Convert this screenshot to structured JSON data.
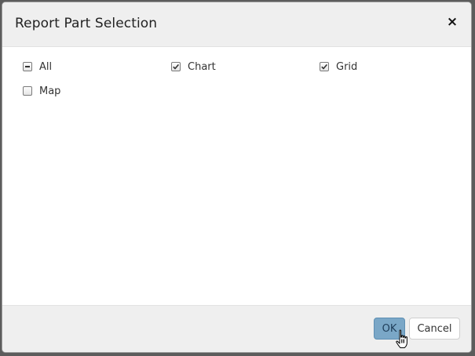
{
  "dialog": {
    "title": "Report Part Selection",
    "close_glyph": "×",
    "options": [
      {
        "label": "All",
        "state": "indeterminate"
      },
      {
        "label": "Chart",
        "state": "checked"
      },
      {
        "label": "Grid",
        "state": "checked"
      },
      {
        "label": "Map",
        "state": "unchecked"
      }
    ],
    "buttons": {
      "ok": "OK",
      "cancel": "Cancel"
    }
  },
  "icons": {
    "close": "close-icon",
    "cursor": "hand-pointer-icon"
  },
  "colors": {
    "ok_button": "#7aa7c7",
    "header_bg": "#efefef"
  }
}
